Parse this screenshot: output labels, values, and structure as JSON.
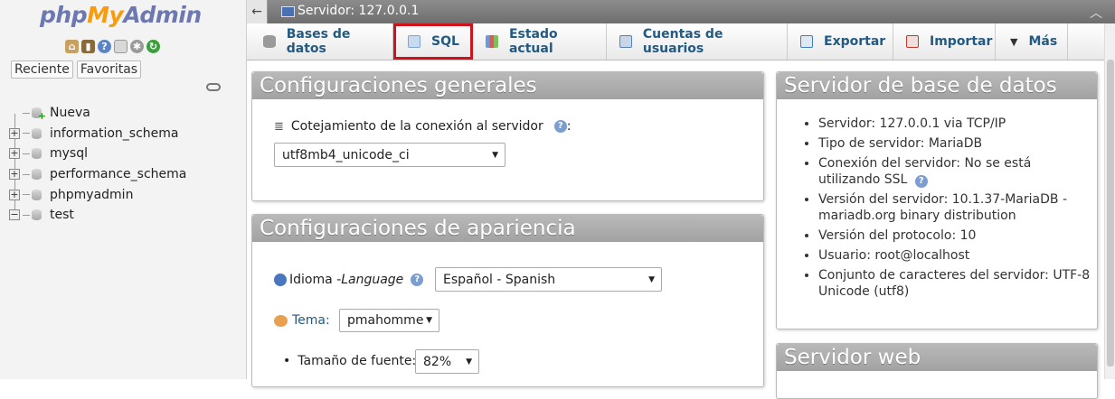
{
  "nav": {
    "logo": {
      "php": "php",
      "my": "My",
      "admin": "Admin"
    },
    "icons": [
      "home-icon",
      "logout-icon",
      "help-icon",
      "docs-icon",
      "settings-icon",
      "reload-icon"
    ],
    "tabs": [
      "Reciente",
      "Favoritas"
    ],
    "tree": [
      {
        "label": "Nueva",
        "type": "new"
      },
      {
        "label": "information_schema",
        "type": "db"
      },
      {
        "label": "mysql",
        "type": "db"
      },
      {
        "label": "performance_schema",
        "type": "db"
      },
      {
        "label": "phpmyadmin",
        "type": "db"
      },
      {
        "label": "test",
        "type": "db-open"
      }
    ]
  },
  "topbar": {
    "back": "←",
    "title": "Servidor: 127.0.0.1"
  },
  "tabs": [
    {
      "label": "Bases de datos",
      "icon": "database-icon",
      "color": "#8a8a8a"
    },
    {
      "label": "SQL",
      "icon": "sql-icon",
      "color": "#7aa6d6"
    },
    {
      "label": "Estado actual",
      "icon": "status-icon",
      "color": "#6a9bd8"
    },
    {
      "label": "Cuentas de usuarios",
      "icon": "users-icon",
      "color": "#5a80b8"
    },
    {
      "label": "Exportar",
      "icon": "export-icon",
      "color": "#3f7fbf"
    },
    {
      "label": "Importar",
      "icon": "import-icon",
      "color": "#c0392b"
    },
    {
      "label": "Más",
      "icon": "caret-down-icon",
      "color": "#333333"
    }
  ],
  "general": {
    "title": "Configuraciones generales",
    "collation_label": "Cotejamiento de la conexión al servidor",
    "collation_suffix": ":",
    "collation_value": "utf8mb4_unicode_ci"
  },
  "appearance": {
    "title": "Configuraciones de apariencia",
    "language_label": "Idioma - ",
    "language_label_em": "Language",
    "language_value": "Español - Spanish",
    "theme_label": "Tema:",
    "theme_value": "pmahomme",
    "font_label": "Tamaño de fuente:",
    "font_value": "82%"
  },
  "dbserver": {
    "title": "Servidor de base de datos",
    "items": [
      "Servidor: 127.0.0.1 via TCP/IP",
      "Tipo de servidor: MariaDB",
      "Conexión del servidor: No se está utilizando SSL",
      "Versión del servidor: 10.1.37-MariaDB - mariadb.org binary distribution",
      "Versión del protocolo: 10",
      "Usuario: root@localhost",
      "Conjunto de caracteres del servidor: UTF-8 Unicode (utf8)"
    ]
  },
  "webserver": {
    "title": "Servidor web"
  }
}
